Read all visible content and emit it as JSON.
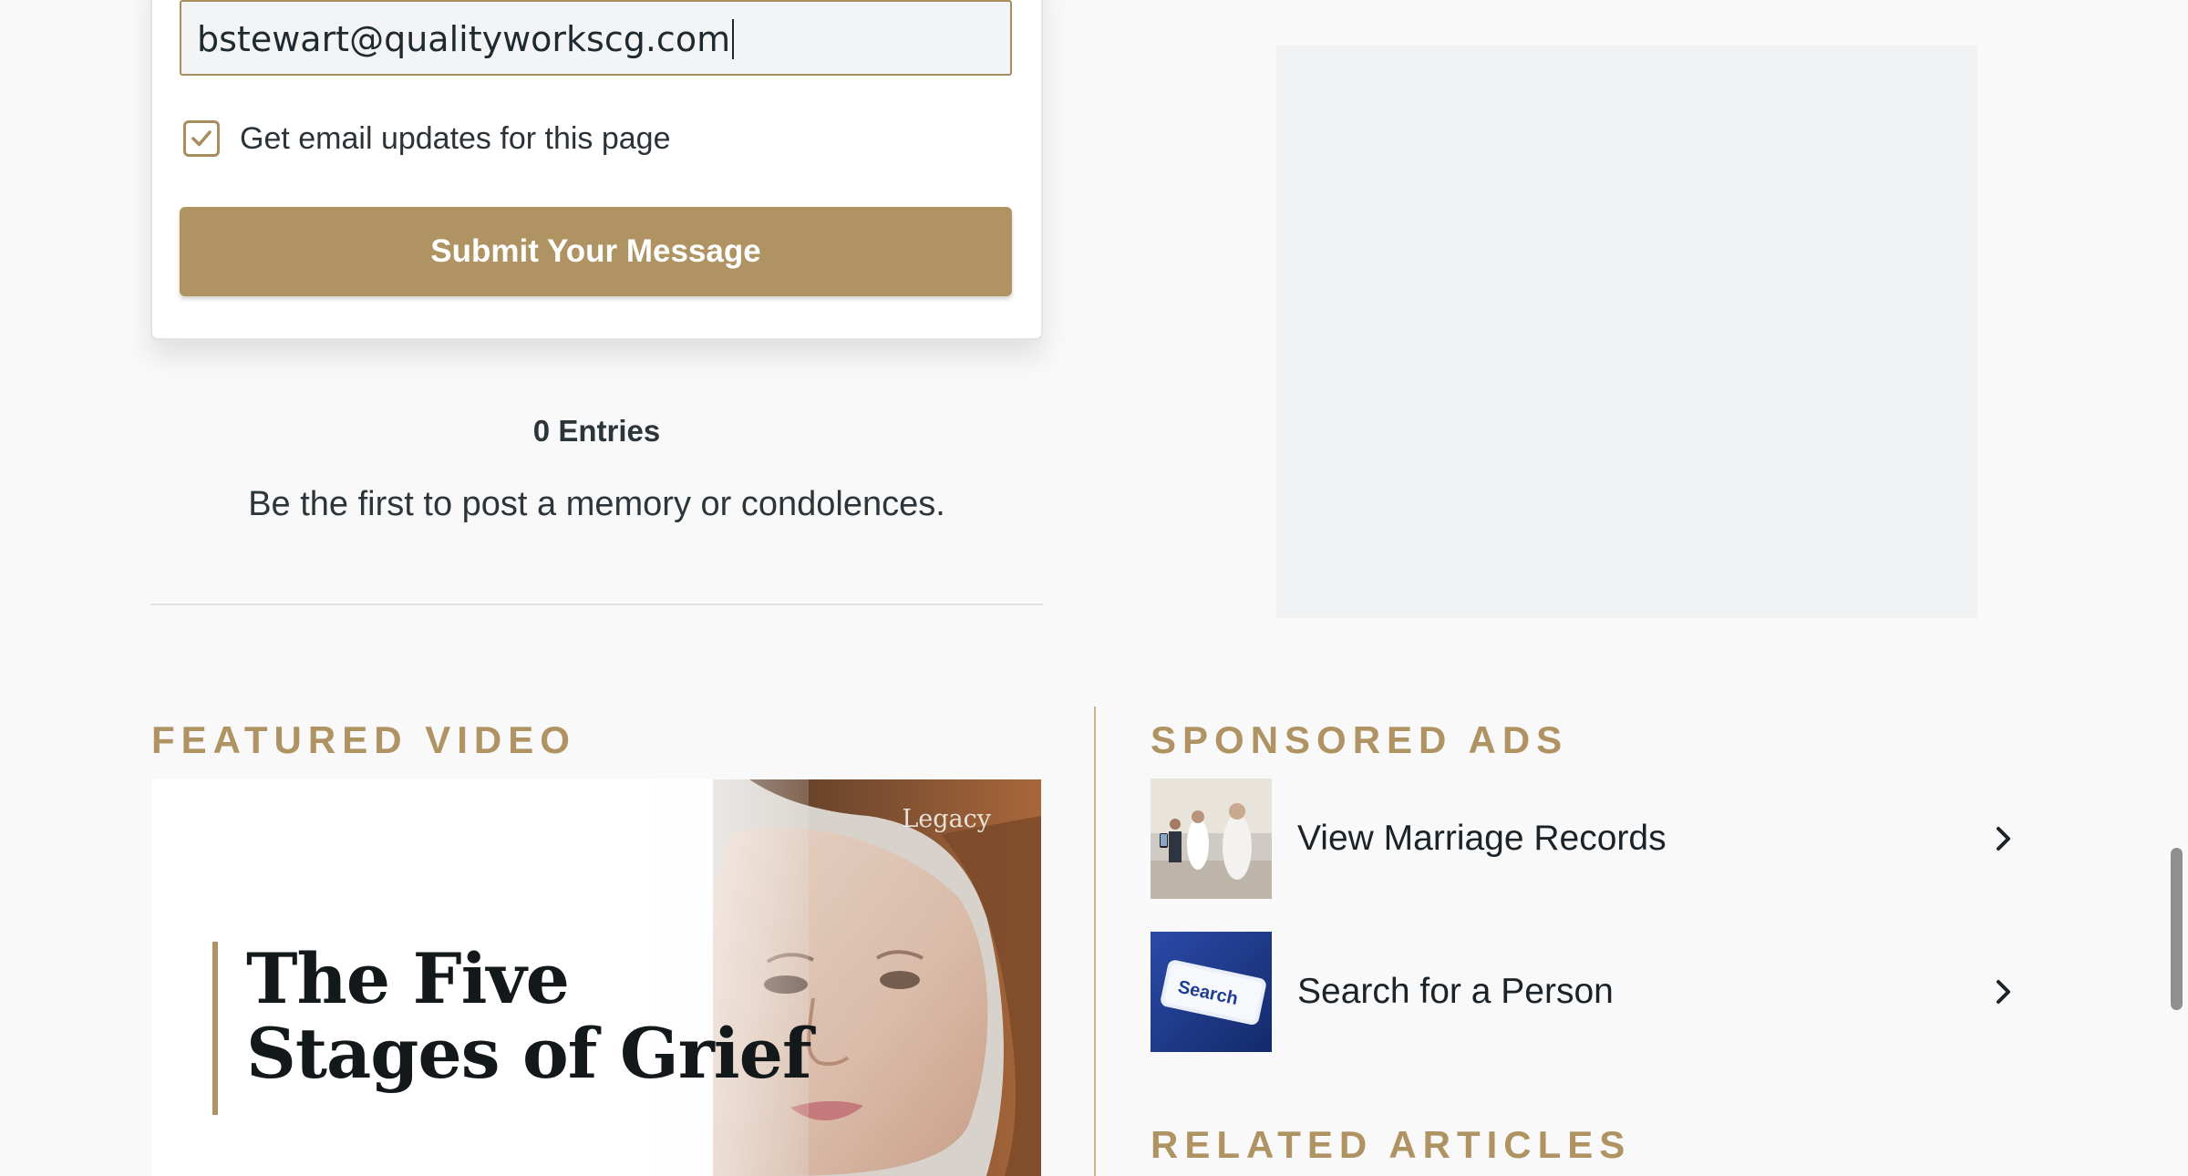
{
  "form": {
    "email_value": "bstewart@qualityworkscg.com",
    "email_updates_label": "Get email updates for this page",
    "email_updates_checked": true,
    "submit_label": "Submit Your Message"
  },
  "entries": {
    "count_label": "0 Entries",
    "empty_message": "Be the first to post a memory or condolences."
  },
  "featured_video": {
    "heading": "FEATURED VIDEO",
    "title": "The Five Stages of Grief",
    "logo_text": "Legacy"
  },
  "sponsored_ads": {
    "heading": "SPONSORED ADS",
    "items": [
      {
        "label": "View Marriage Records",
        "thumb_icon": "wedding-photo-thumbnail"
      },
      {
        "label": "Search for a Person",
        "thumb_icon": "search-key-thumbnail",
        "thumb_text": "Search"
      }
    ]
  },
  "related_articles": {
    "heading": "RELATED ARTICLES"
  },
  "colors": {
    "accent_gold": "#b09363",
    "text_dark": "#1f2a30",
    "page_bg": "#f9f9f9",
    "ad_placeholder": "#f1f2f4"
  }
}
